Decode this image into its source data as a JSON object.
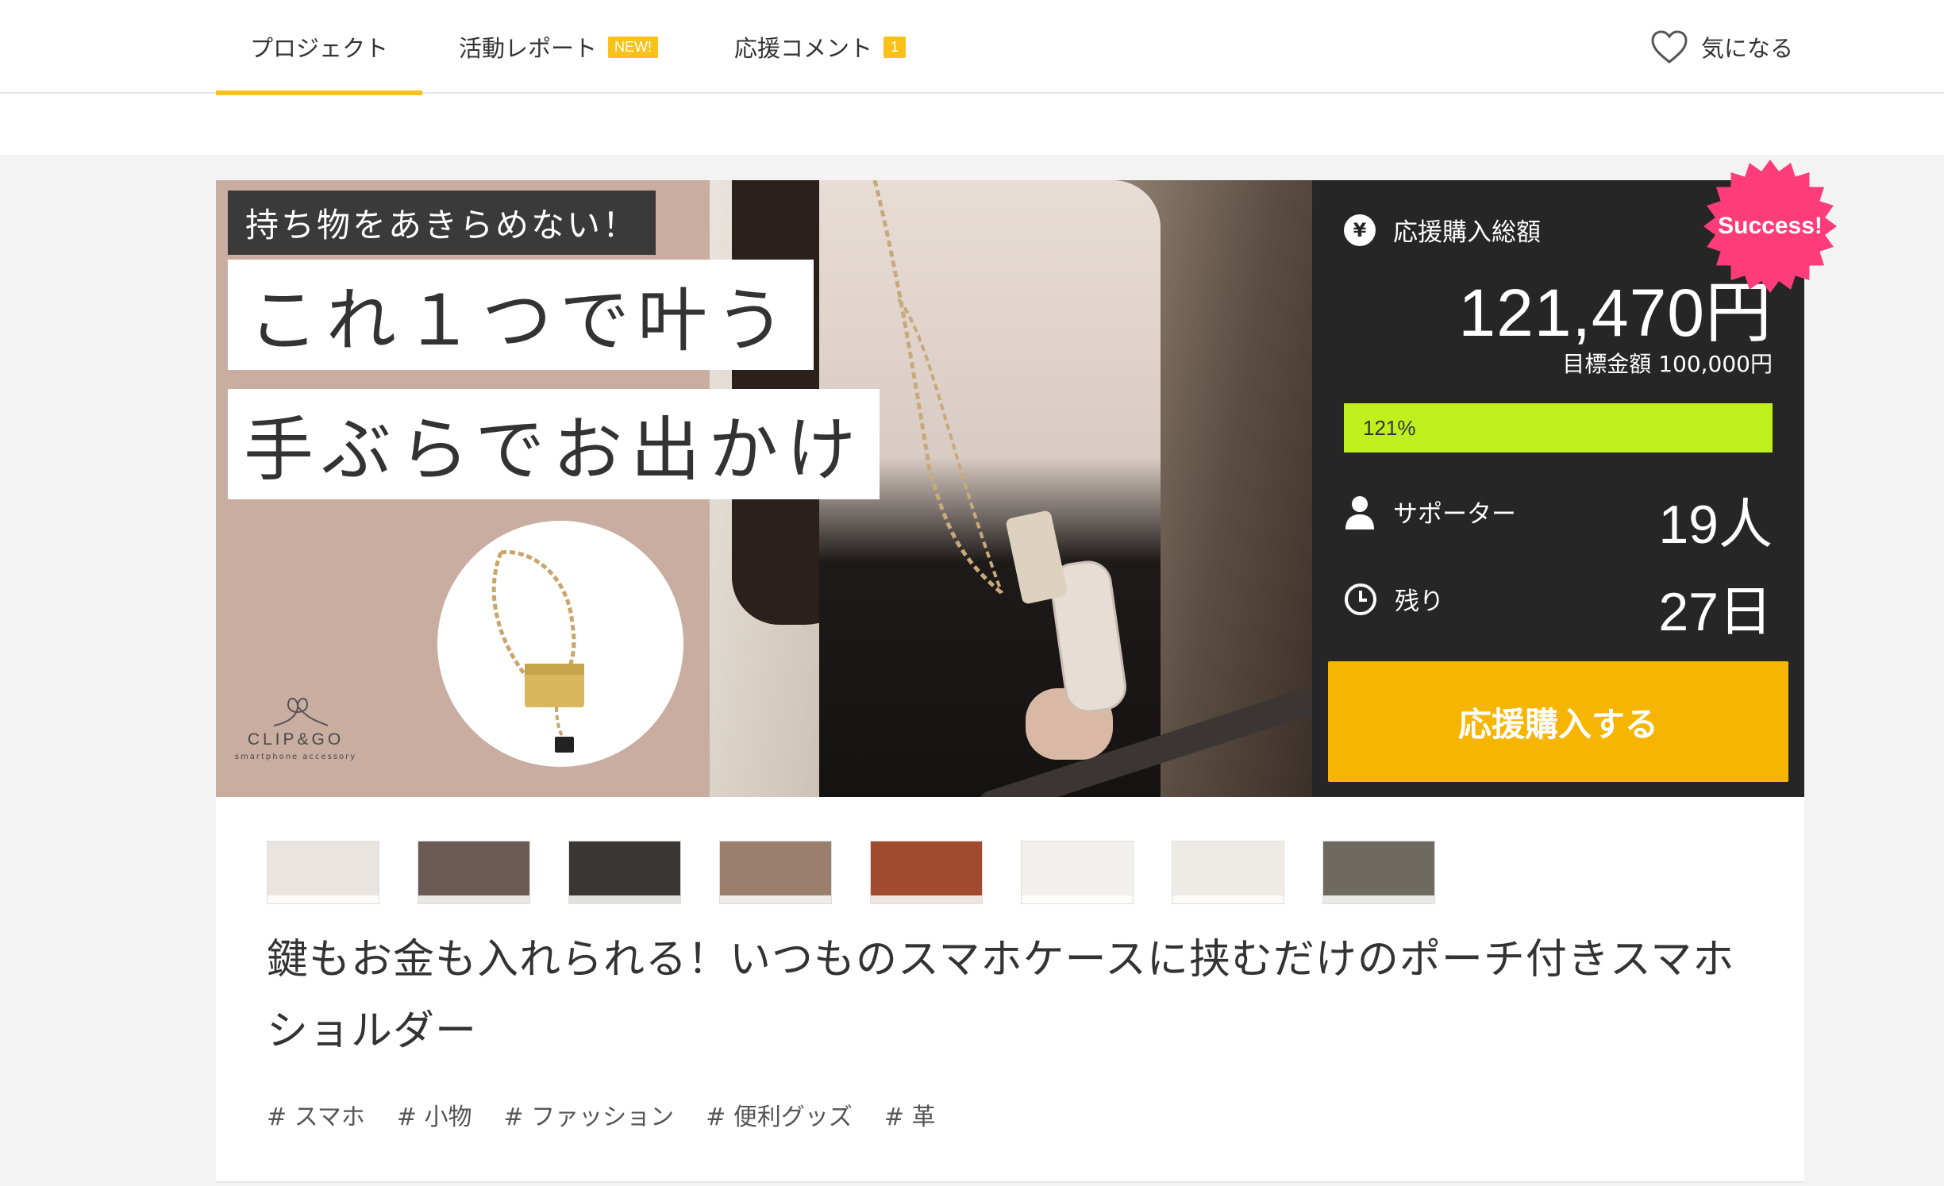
{
  "nav": {
    "tabs": [
      {
        "label": "プロジェクト"
      },
      {
        "label": "活動レポート",
        "badge": "NEW!"
      },
      {
        "label": "応援コメント",
        "badge": "1"
      }
    ],
    "favorite_label": "気になる"
  },
  "hero": {
    "tagline": "持ち物をあきらめない！",
    "headline_1": "これ１つで叶う",
    "headline_2": "手ぶらでお出かけ",
    "brand_name": "CLIP&GO",
    "brand_sub": "smartphone accessory"
  },
  "funding": {
    "badge": "Success!",
    "total_label": "応援購入総額",
    "total_value": "121,470円",
    "goal_text": "目標金額 100,000円",
    "progress_fraction": 1.0,
    "progress_text": "121%",
    "supporters_label": "サポーター",
    "supporters_value": "19人",
    "remaining_label": "残り",
    "remaining_value": "27日",
    "cta_label": "応援購入する",
    "icons": {
      "total": "yen-icon",
      "supporters": "person-icon",
      "remaining": "clock-icon"
    }
  },
  "thumbnails": [
    {
      "name": "thumb-1",
      "color": "#e9e4df"
    },
    {
      "name": "thumb-2",
      "color": "#6b5a55"
    },
    {
      "name": "thumb-3",
      "color": "#3a3633"
    },
    {
      "name": "thumb-4",
      "color": "#9a7f6c"
    },
    {
      "name": "thumb-5",
      "color": "#a04b2e"
    },
    {
      "name": "thumb-6",
      "color": "#f2f0ec"
    },
    {
      "name": "thumb-7",
      "color": "#eeeae5"
    },
    {
      "name": "thumb-8",
      "color": "#6e6a62"
    }
  ],
  "project": {
    "title": "鍵もお金も入れられる！いつものスマホケースに挟むだけのポーチ付きスマホショルダー",
    "tags": [
      "# スマホ",
      "# 小物",
      "# ファッション",
      "# 便利グッズ",
      "# 革"
    ]
  },
  "colors": {
    "accent": "#f8c21a",
    "cta": "#f6b500",
    "progress": "#bff01d",
    "success": "#ff3c7a",
    "panel": "#262626"
  }
}
